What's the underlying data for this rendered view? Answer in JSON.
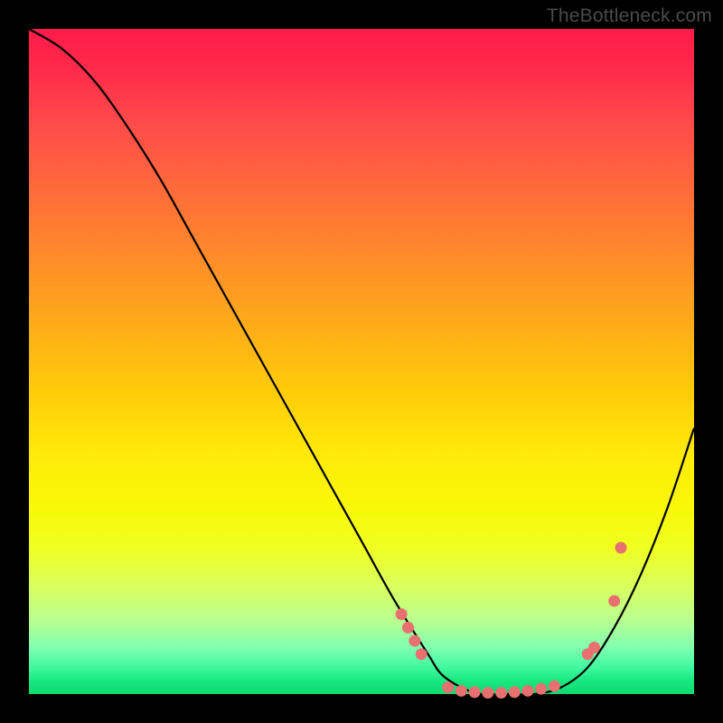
{
  "watermark": "TheBottleneck.com",
  "chart_data": {
    "type": "line",
    "title": "",
    "xlabel": "",
    "ylabel": "",
    "xlim": [
      0,
      100
    ],
    "ylim": [
      0,
      100
    ],
    "curve": {
      "name": "bottleneck-curve",
      "x": [
        0,
        5,
        10,
        15,
        20,
        25,
        30,
        35,
        40,
        45,
        50,
        55,
        60,
        62,
        65,
        68,
        72,
        76,
        80,
        84,
        88,
        92,
        96,
        100
      ],
      "y": [
        100,
        97,
        92,
        85,
        77,
        68,
        59,
        50,
        41,
        32,
        23,
        14,
        6,
        3,
        1,
        0,
        0,
        0,
        1,
        4,
        10,
        18,
        28,
        40
      ]
    },
    "markers": {
      "name": "highlight-points",
      "color": "#e87070",
      "x": [
        56,
        57,
        58,
        59,
        63,
        65,
        67,
        69,
        71,
        73,
        75,
        77,
        79,
        84,
        85,
        88,
        89
      ],
      "y": [
        12,
        10,
        8,
        6,
        1,
        0.5,
        0.3,
        0.2,
        0.2,
        0.3,
        0.5,
        0.8,
        1.2,
        6,
        7,
        14,
        22
      ]
    },
    "background_gradient": {
      "top_color": "#ff1a4a",
      "bottom_color": "#10d870"
    }
  }
}
